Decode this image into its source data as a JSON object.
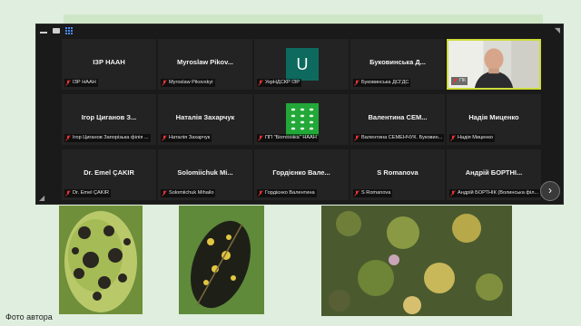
{
  "caption": "Фото автора",
  "participants": [
    {
      "name": "ІЗР НААН",
      "label": "ІЗР НААН"
    },
    {
      "name": "Myroslaw Pikov...",
      "label": "Myroslaw Pikovskyi"
    },
    {
      "name": "",
      "label": "УкрНДСКР ІЗР",
      "avatar_letter": "U"
    },
    {
      "name": "Буковинська Д...",
      "label": "Буковинська ДСГДС"
    },
    {
      "name": "",
      "label": "ПК"
    },
    {
      "name": "Ігор Циганов З...",
      "label": "Ігор Циганов Запорізька філія ..."
    },
    {
      "name": "Наталія Захарчук",
      "label": "Наталія Захарчук"
    },
    {
      "name": "",
      "label": "ПП \"Біотехніка\" НААН"
    },
    {
      "name": "Валентина СЕМ...",
      "label": "Валентина СЕМЕНЧУК. Буковин..."
    },
    {
      "name": "Надія Миценко",
      "label": "Надія Миценко"
    },
    {
      "name": "Dr. Emel ÇAKIR",
      "label": "Dr. Emel ÇAKIR"
    },
    {
      "name": "Solomiichuk Mi...",
      "label": "Solomiichuk Mihailo"
    },
    {
      "name": "Гордієнко Вале...",
      "label": "Гордієнко Валентина"
    },
    {
      "name": "S Romanova",
      "label": "S Romanova"
    },
    {
      "name": "Андрій БОРТНІ...",
      "label": "Андрій БОРТНІК (Волинська філ..."
    }
  ],
  "next_page_glyph": "›",
  "more_glyph": "···"
}
